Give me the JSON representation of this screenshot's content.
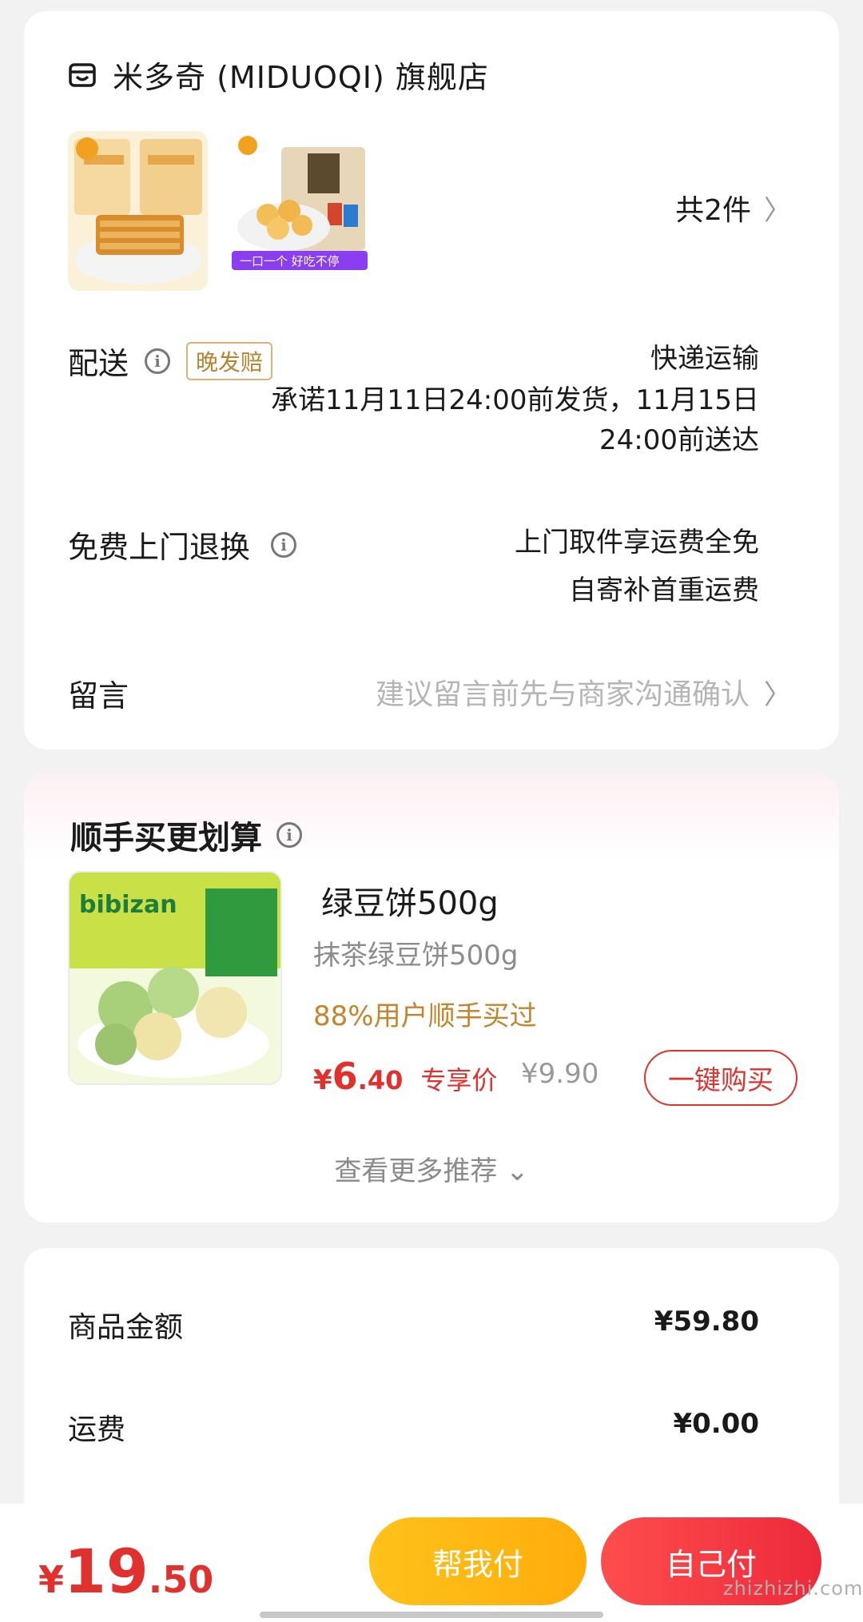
{
  "store": {
    "name": "米多奇 (MIDUOQI) 旗舰店",
    "item_count": "共2件",
    "thumb2_banner": "一口一个 好吃不停"
  },
  "delivery": {
    "label": "配送",
    "badge": "晚发赔",
    "method": "快递运输",
    "promise": "承诺11月11日24:00前发货，11月15日24:00前送达"
  },
  "returns": {
    "label": "免费上门退换",
    "line1": "上门取件享运费全免",
    "line2": "自寄补首重运费"
  },
  "message": {
    "label": "留言",
    "placeholder": "建议留言前先与商家沟通确认"
  },
  "addon": {
    "title": "顺手买更划算",
    "product_name": "绿豆饼500g",
    "variant": "抹茶绿豆饼500g",
    "social_proof": "88%用户顺手买过",
    "price_symbol": "¥",
    "price_int": "6",
    "price_dec": ".40",
    "price_tag": "专享价",
    "original_price": "¥9.90",
    "buy_label": "一键购买",
    "more_label": "查看更多推荐 ⌄"
  },
  "summary": {
    "goods_label": "商品金额",
    "goods_value": "¥59.80",
    "shipping_label": "运费",
    "shipping_value": "¥0.00"
  },
  "footer": {
    "total_symbol": "¥",
    "total_int": "19",
    "total_dec": ".50",
    "help_pay_label": "帮我付",
    "self_pay_label": "自己付",
    "watermark": "zhizhizhi.com"
  },
  "colors": {
    "accent_red": "#e0312e",
    "accent_yellow": "#ffb915",
    "badge_gold": "#b8832f"
  }
}
